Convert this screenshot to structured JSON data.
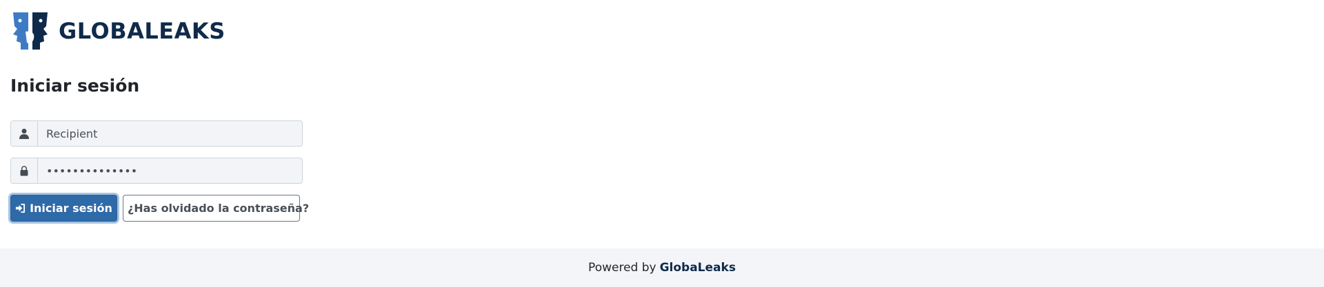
{
  "header": {
    "logo_text": "GLOBALEAKS",
    "logo_icon": "globaleaks-faces-icon"
  },
  "login": {
    "title": "Iniciar sesión",
    "username": {
      "value": "Recipient",
      "icon": "user-icon"
    },
    "password": {
      "value": "••••••••••••••",
      "icon": "lock-icon"
    },
    "submit_label": "Iniciar sesión",
    "submit_icon": "sign-in-icon",
    "forgot_label": "¿Has olvidado la contraseña?"
  },
  "footer": {
    "powered_by": "Powered by",
    "brand": "GlobaLeaks"
  },
  "colors": {
    "brand_dark": "#0f2a4a",
    "primary": "#2f6aa8",
    "footer_bg": "#f4f5f9"
  }
}
